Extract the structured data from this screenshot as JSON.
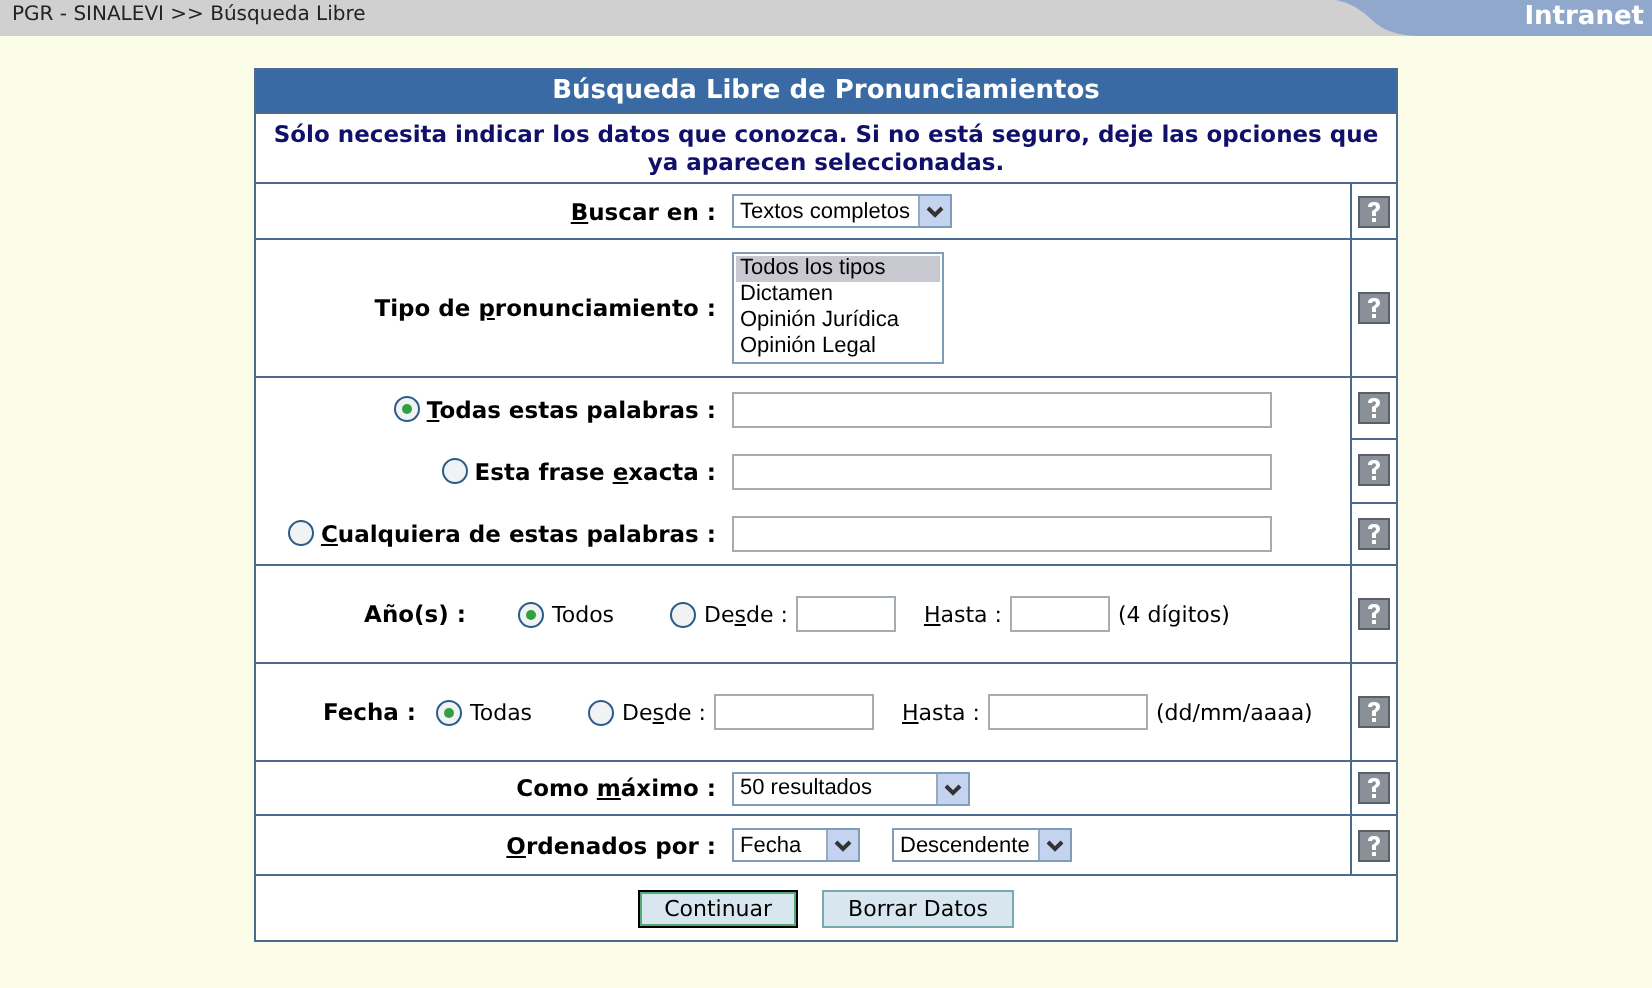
{
  "top_bar": {
    "breadcrumb": "PGR - SINALEVI >> Búsqueda Libre",
    "tab": "Intranet"
  },
  "form": {
    "title": "Búsqueda Libre de Pronunciamientos",
    "intro": "Sólo necesita indicar los datos que conozca. Si no está seguro, deje las opciones que ya aparecen seleccionadas.",
    "search_in": {
      "key": "B",
      "post": "uscar en :",
      "value": "Textos completos"
    },
    "type": {
      "pre": "Tipo de ",
      "key": "p",
      "post": "ronunciamiento :",
      "options": [
        {
          "label": "Todos los tipos",
          "selected": true
        },
        {
          "label": "Dictamen",
          "selected": false
        },
        {
          "label": "Opinión Jurídica",
          "selected": false
        },
        {
          "label": "Opinión Legal",
          "selected": false
        }
      ]
    },
    "word_modes": [
      {
        "key": "T",
        "post": "odas estas palabras :",
        "selected": true
      },
      {
        "pre": "Esta frase ",
        "key": "e",
        "post": "xacta :",
        "selected": false
      },
      {
        "key": "C",
        "post": "ualquiera de estas palabras :",
        "selected": false
      }
    ],
    "years": {
      "label": "Año(s) :",
      "all": {
        "label": "Todos",
        "selected": true
      },
      "from": {
        "pre": "De",
        "key": "s",
        "post": "de :",
        "selected": false
      },
      "to": {
        "key": "H",
        "post": "asta :"
      },
      "hint": "(4 dígitos)"
    },
    "dates": {
      "label": "Fecha :",
      "all": {
        "label": "Todas",
        "selected": true
      },
      "from": {
        "pre": "De",
        "key": "s",
        "post": "de :",
        "selected": false
      },
      "to": {
        "key": "H",
        "post": "asta :"
      },
      "hint": "(dd/mm/aaaa)"
    },
    "max": {
      "pre": "Como ",
      "key": "m",
      "post": "áximo :",
      "value": "50 resultados"
    },
    "order": {
      "key": "O",
      "post": "rdenados por :",
      "field": "Fecha",
      "direction": "Descendente"
    },
    "buttons": [
      {
        "label": "Continuar",
        "focused": true
      },
      {
        "label": "Borrar Datos",
        "focused": false
      }
    ]
  }
}
